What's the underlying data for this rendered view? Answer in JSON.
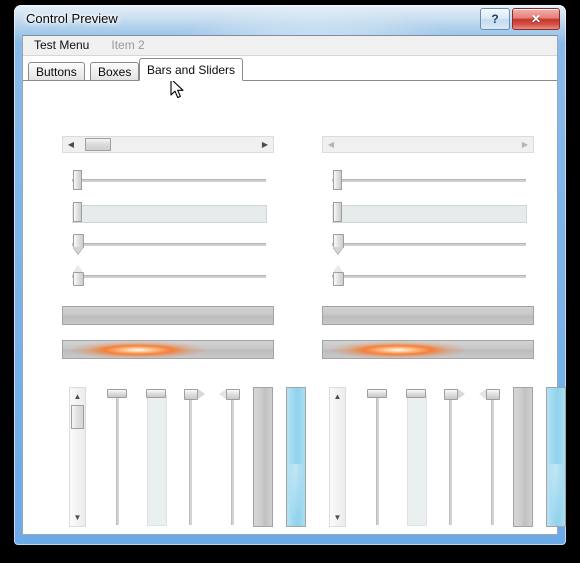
{
  "window": {
    "title": "Control Preview",
    "caption_buttons": [
      {
        "name": "help-button",
        "label": "?"
      },
      {
        "name": "close-button",
        "label": "✕"
      }
    ]
  },
  "menubar": {
    "items": [
      {
        "label": "Test Menu",
        "enabled": true
      },
      {
        "label": "Item 2",
        "enabled": false
      }
    ]
  },
  "tabs": [
    {
      "label": "Buttons",
      "active": false
    },
    {
      "label": "Boxes",
      "active": false
    },
    {
      "label": "Bars and Sliders",
      "active": true
    }
  ],
  "controls": {
    "scrollbar_horizontal": {
      "left_arrow": "◀",
      "right_arrow": "▶",
      "thumb_position_percent": 10
    },
    "scrollbar_horizontal_disabled": {
      "left_arrow": "◀",
      "right_arrow": "▶",
      "thumb_position_percent": 0
    },
    "slider_plain": {
      "value_percent": 1
    },
    "slider_filled": {
      "value_percent": 1
    },
    "slider_pointer_down": {
      "value_percent": 1
    },
    "slider_pointer_up": {
      "value_percent": 1
    },
    "progress_empty": {
      "value_percent": 0
    },
    "progress_marquee": {
      "value_percent": 35,
      "accent_color": "#f4803a"
    },
    "scrollbar_vertical": {
      "up_arrow": "▲",
      "down_arrow": "▼",
      "thumb_position_percent": 8
    },
    "scrollbar_vertical_disabled": {
      "up_arrow": "▲",
      "down_arrow": "▼"
    },
    "vslider_plain": {
      "value_percent": 100
    },
    "vslider_filled": {
      "value_percent": 100
    },
    "vslider_pointer_right": {
      "value_percent": 100
    },
    "vslider_pointer_left": {
      "value_percent": 100
    },
    "vprogress_empty": {
      "value_percent": 0
    },
    "vprogress_full": {
      "value_percent": 100,
      "accent_color": "#8fd2ee"
    }
  },
  "colors": {
    "window_frame": "#6eaeec",
    "titlebar_glass": "#bad9f3",
    "close_button": "#c6342a",
    "client_background": "#ffffff",
    "progress_accent": "#f4803a",
    "progress_blue": "#8fd2ee"
  }
}
